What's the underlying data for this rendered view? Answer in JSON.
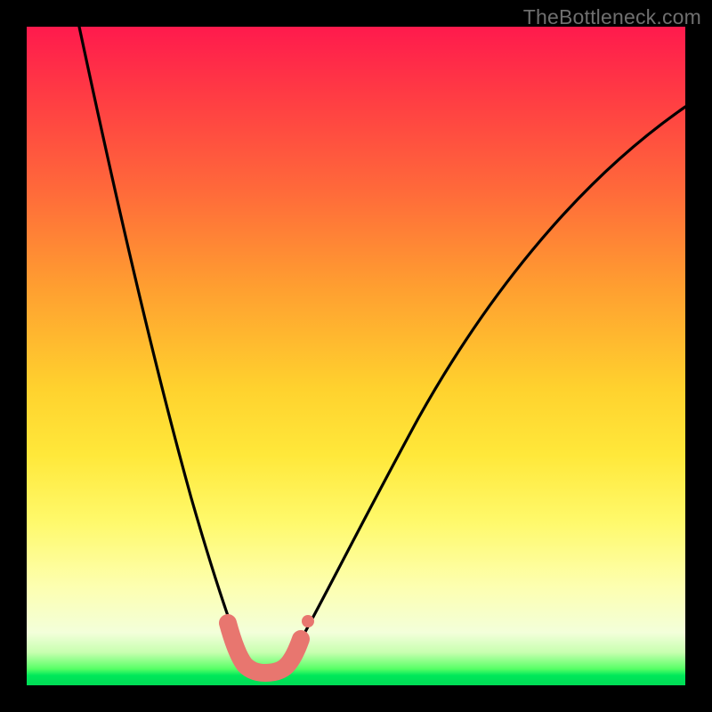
{
  "watermark": "TheBottleneck.com",
  "chart_data": {
    "type": "line",
    "title": "",
    "xlabel": "",
    "ylabel": "",
    "xlim": [
      0,
      100
    ],
    "ylim": [
      0,
      100
    ],
    "background_gradient": {
      "top_color": "#ff1a4d",
      "mid_color": "#ffe83a",
      "bottom_color": "#00db55"
    },
    "series": [
      {
        "name": "bottleneck-curve",
        "stroke": "#000000",
        "x": [
          8,
          12,
          16,
          20,
          24,
          27,
          29,
          31,
          33,
          34.5,
          36,
          38,
          40,
          44,
          50,
          58,
          68,
          80,
          92,
          100
        ],
        "y": [
          100,
          84,
          68,
          52,
          36,
          22,
          13,
          7,
          3,
          2,
          2,
          3,
          5,
          10,
          20,
          33,
          48,
          62,
          74,
          80
        ]
      }
    ],
    "highlight_segment": {
      "name": "valley-marker",
      "stroke": "#e8766f",
      "x": [
        30.5,
        31.5,
        32.5,
        33.5,
        34.5,
        35.5,
        36.5,
        37.5,
        38.5,
        39.3
      ],
      "y": [
        7.5,
        4.5,
        2.8,
        2.0,
        2.0,
        2.0,
        2.0,
        2.3,
        3.2,
        5.5
      ]
    }
  }
}
